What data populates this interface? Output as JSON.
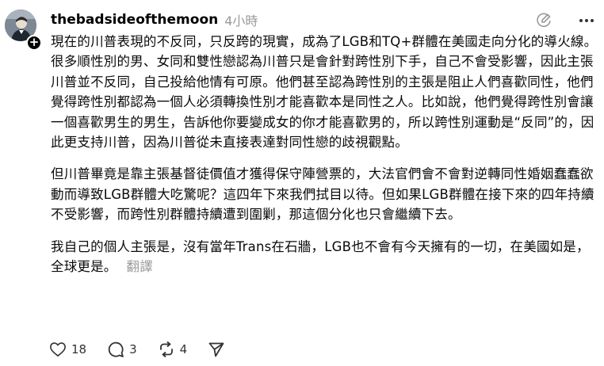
{
  "post": {
    "username": "thebadsideofthemoon",
    "timestamp": "4小時",
    "paragraphs": [
      "現在的川普表現的不反同，只反跨的現實，成為了LGB和TQ+群體在美國走向分化的導火線。很多順性別的男、女同和雙性戀認為川普只是會針對跨性別下手，自己不會受影響，因此主張川普並不反同，自己投給他情有可原。他們甚至認為跨性別的主張是阻止人們喜歡同性，他們覺得跨性別都認為一個人必須轉換性別才能喜歡本是同性之人。比如說，他們覺得跨性別會讓一個喜歡男生的男生，告訴他你要變成女的你才能喜歡男的，所以跨性別運動是“反同”的，因此更支持川普，因為川普從未直接表達對同性戀的歧視觀點。",
      "但川普畢竟是靠主張基督徒價值才獲得保守陣營票的，大法官們會不會對逆轉同性婚姻蠢蠢欲動而導致LGB群體大吃驚呢？這四年下來我們拭目以待。但如果LGB群體在接下來的四年持續不受影響，而跨性別群體持續遭到圍剿，那這個分化也只會繼續下去。",
      "我自己的個人主張是，沒有當年Trans在石牆，LGB也不會有今天擁有的一切，在美國如是，全球更是。"
    ],
    "translate_label": "翻譯"
  },
  "actions": {
    "likes": "18",
    "replies": "3",
    "reposts": "4"
  },
  "icons": {
    "follow": "plus-icon",
    "edit": "edit-icon",
    "more": "more-icon",
    "like": "heart-icon",
    "reply": "comment-icon",
    "repost": "repost-icon",
    "share": "send-icon"
  }
}
